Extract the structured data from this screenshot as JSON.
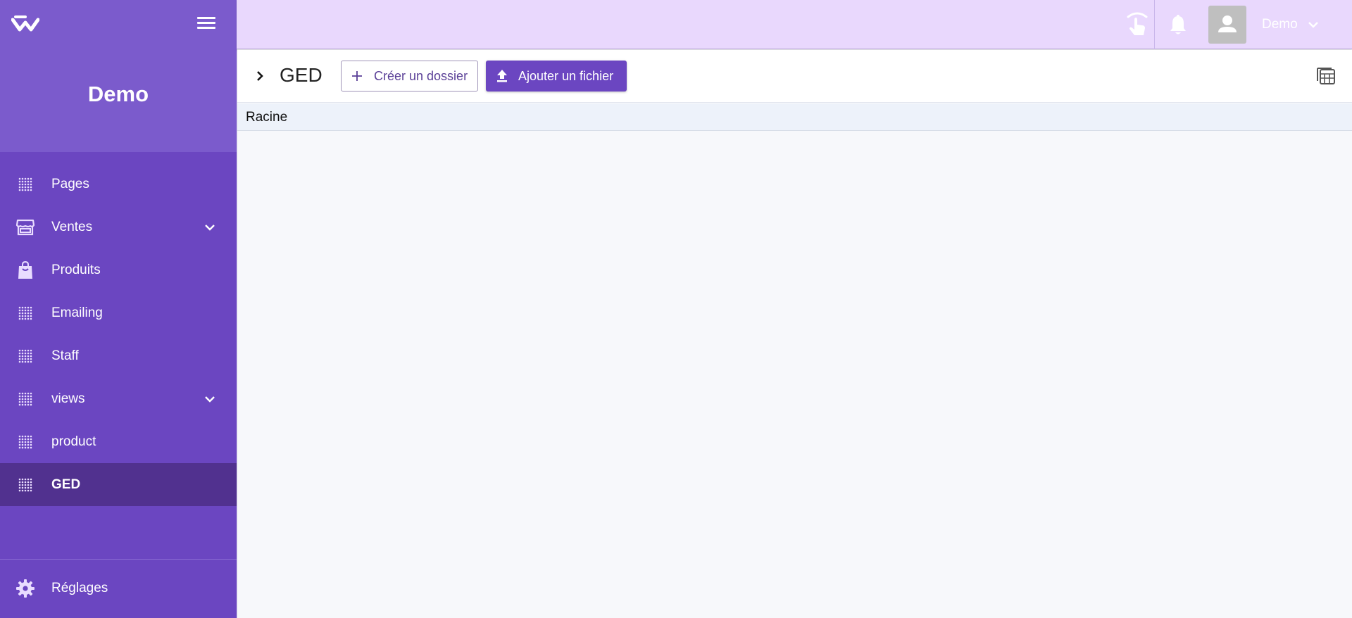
{
  "app": {
    "name": "Demo"
  },
  "sidebar": {
    "items": [
      {
        "label": "Pages",
        "icon": "dots-grid-icon",
        "has_children": false,
        "active": false
      },
      {
        "label": "Ventes",
        "icon": "store-icon",
        "has_children": true,
        "active": false
      },
      {
        "label": "Produits",
        "icon": "shopping-bag-icon",
        "has_children": false,
        "active": false
      },
      {
        "label": "Emailing",
        "icon": "dots-grid-icon",
        "has_children": false,
        "active": false
      },
      {
        "label": "Staff",
        "icon": "dots-grid-icon",
        "has_children": false,
        "active": false
      },
      {
        "label": "views",
        "icon": "dots-grid-icon",
        "has_children": true,
        "active": false
      },
      {
        "label": "product",
        "icon": "dots-grid-icon",
        "has_children": false,
        "active": false
      },
      {
        "label": "GED",
        "icon": "dots-grid-icon",
        "has_children": false,
        "active": true
      }
    ],
    "settings_label": "Réglages"
  },
  "topbar": {
    "user_name": "Demo"
  },
  "toolbar": {
    "title": "GED",
    "create_folder_label": "Créer un dossier",
    "add_file_label": "Ajouter un fichier"
  },
  "breadcrumb": {
    "root": "Racine"
  },
  "colors": {
    "sidebar_bg": "#6b46c1",
    "sidebar_header_bg": "#7b5bcc",
    "sidebar_active_bg": "#51318f",
    "topbar_bg": "#e9d8fd",
    "primary": "#6b46c1",
    "breadcrumb_bg": "#edf2fa"
  }
}
